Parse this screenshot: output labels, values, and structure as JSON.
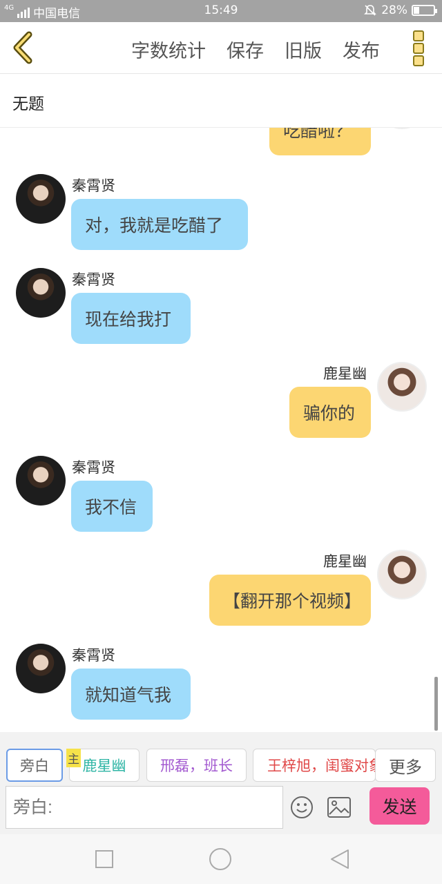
{
  "status_bar": {
    "network": "4G",
    "carrier": "中国电信",
    "time": "15:49",
    "battery": "28%",
    "battery_level": 0.28
  },
  "nav": {
    "word_count": "字数统计",
    "save": "保存",
    "old_version": "旧版",
    "publish": "发布"
  },
  "document": {
    "title": "无题"
  },
  "messages": [
    {
      "side": "right",
      "name": "",
      "text": "吃醋啦？"
    },
    {
      "side": "left",
      "name": "秦霄贤",
      "text": "对，我就是吃醋了"
    },
    {
      "side": "left",
      "name": "秦霄贤",
      "text": "现在给我打"
    },
    {
      "side": "right",
      "name": "鹿星幽",
      "text": "骗你的"
    },
    {
      "side": "left",
      "name": "秦霄贤",
      "text": "我不信"
    },
    {
      "side": "right",
      "name": "鹿星幽",
      "text": "【翻开那个视频】"
    },
    {
      "side": "left",
      "name": "秦霄贤",
      "text": "就知道气我"
    }
  ],
  "roles": {
    "narrator": "旁白",
    "main_badge": "主",
    "role1": "鹿星幽",
    "role2": "邢磊，班长",
    "role3": "王梓旭，闺蜜对象",
    "more": "更多"
  },
  "input": {
    "placeholder": "旁白:"
  },
  "send_label": "发送",
  "colors": {
    "left_bubble": "#9fdcfb",
    "right_bubble": "#fcd672",
    "send_button": "#f45b9a",
    "role1_text": "#2fb5a5",
    "role2_text": "#a35ad0",
    "role3_text": "#e04848"
  }
}
